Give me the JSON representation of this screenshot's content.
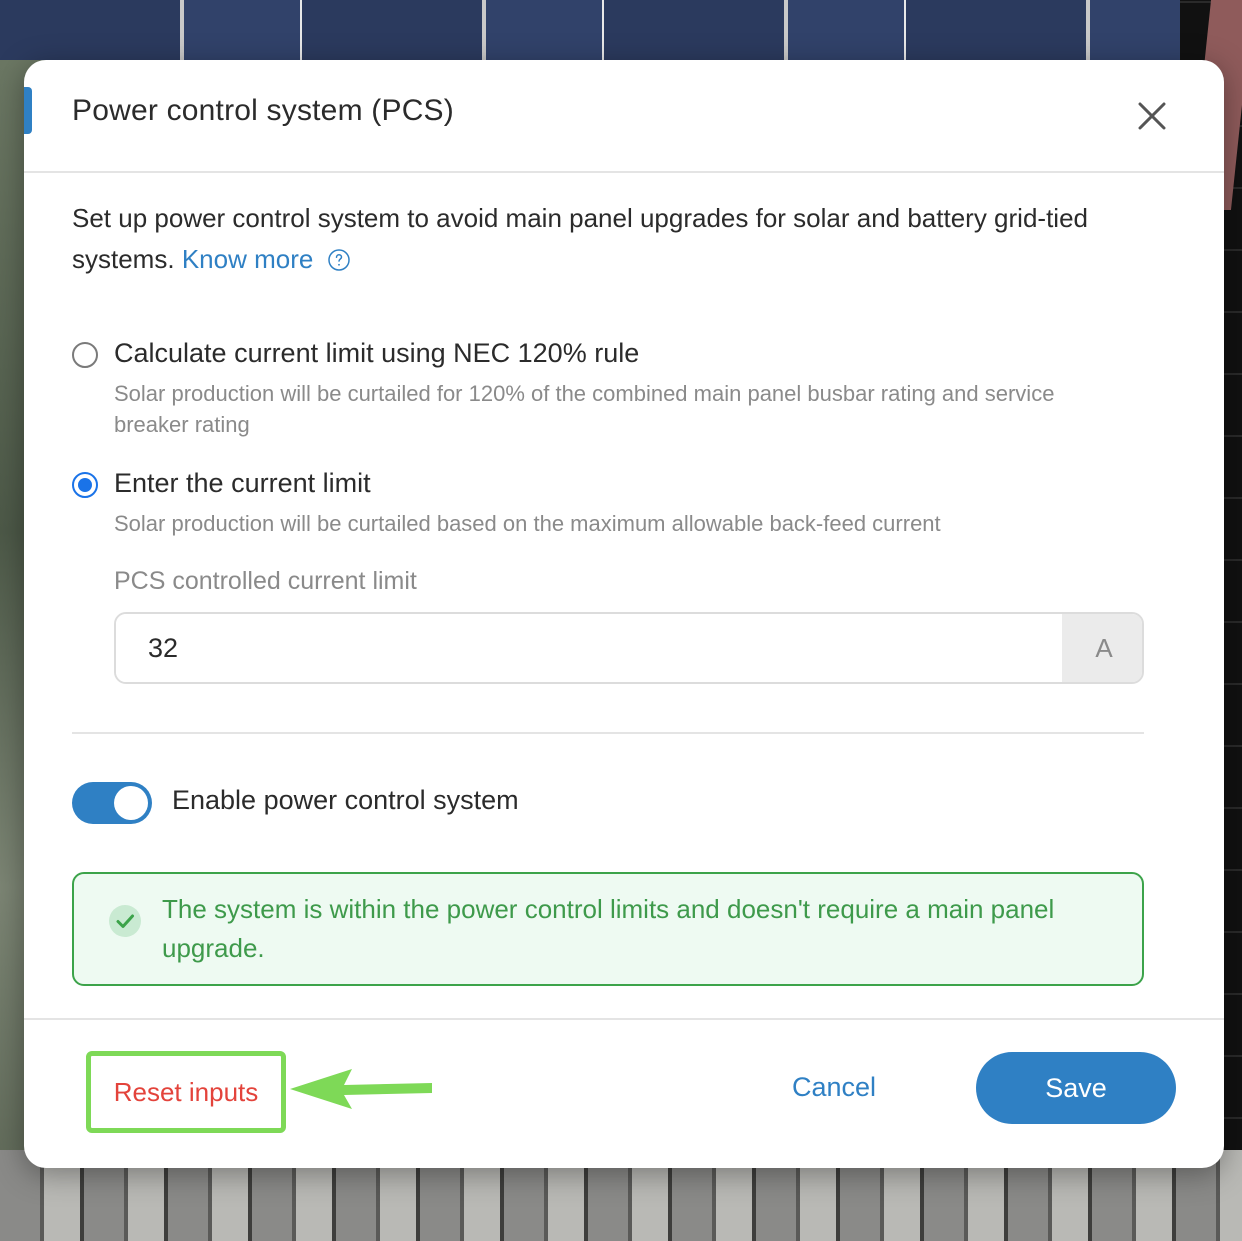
{
  "dialog": {
    "title": "Power control system (PCS)",
    "close_icon": "close-icon",
    "intro_text": "Set up power control system to avoid main panel upgrades for solar and battery grid-tied systems.",
    "know_more_label": "Know more",
    "help_icon": "question-circle-icon"
  },
  "options": [
    {
      "label": "Calculate current limit using NEC 120% rule",
      "description": "Solar production will be curtailed for 120% of the combined main panel busbar rating and service breaker rating",
      "selected": false
    },
    {
      "label": "Enter the current limit",
      "description": "Solar production will be curtailed based on the maximum allowable back-feed current",
      "selected": true
    }
  ],
  "current_limit": {
    "label": "PCS controlled current limit",
    "value": "32",
    "unit": "A"
  },
  "toggle": {
    "label": "Enable power control system",
    "enabled": true
  },
  "status": {
    "icon": "check-circle-icon",
    "message": "The system is within the power control limits and doesn't require a main panel upgrade."
  },
  "footer": {
    "reset_label": "Reset inputs",
    "cancel_label": "Cancel",
    "save_label": "Save"
  },
  "colors": {
    "accent": "#2f80c4",
    "radio_selected": "#1a73e8",
    "success": "#3ca34a",
    "success_bg": "#eefaf2",
    "danger": "#e3433b",
    "highlight": "#7ed957"
  }
}
